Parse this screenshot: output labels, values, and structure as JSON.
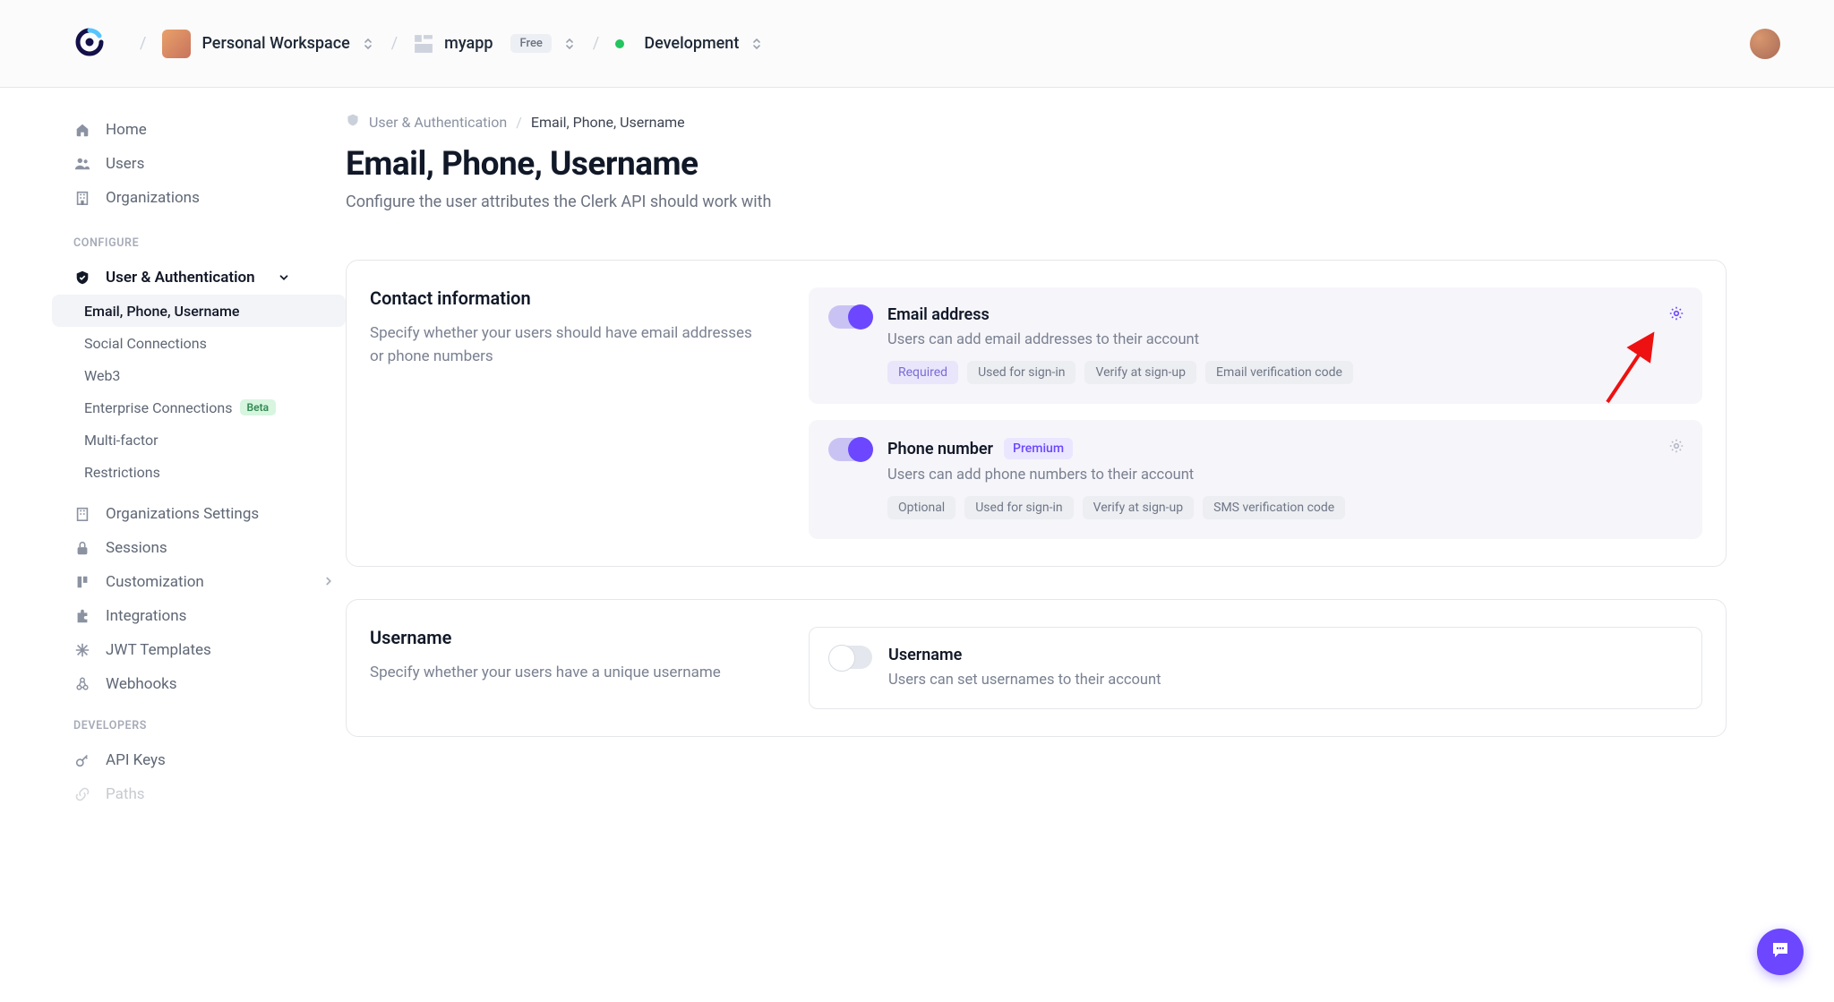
{
  "breadcrumb": {
    "workspace": "Personal Workspace",
    "app": "myapp",
    "app_badge": "Free",
    "env": "Development"
  },
  "sidebar": {
    "top": [
      {
        "label": "Home"
      },
      {
        "label": "Users"
      },
      {
        "label": "Organizations"
      }
    ],
    "config_header": "CONFIGURE",
    "auth_parent": "User & Authentication",
    "auth_children": [
      {
        "label": "Email, Phone, Username"
      },
      {
        "label": "Social Connections"
      },
      {
        "label": "Web3"
      },
      {
        "label": "Enterprise Connections",
        "beta": "Beta"
      },
      {
        "label": "Multi-factor"
      },
      {
        "label": "Restrictions"
      }
    ],
    "rest": [
      {
        "label": "Organizations Settings"
      },
      {
        "label": "Sessions"
      },
      {
        "label": "Customization"
      },
      {
        "label": "Integrations"
      },
      {
        "label": "JWT Templates"
      },
      {
        "label": "Webhooks"
      }
    ],
    "dev_header": "DEVELOPERS",
    "dev": [
      {
        "label": "API Keys"
      },
      {
        "label": "Paths"
      }
    ]
  },
  "crumbs": {
    "a": "User & Authentication",
    "b": "Email, Phone, Username"
  },
  "page": {
    "title": "Email, Phone, Username",
    "subtitle": "Configure the user attributes the Clerk API should work with"
  },
  "contact": {
    "heading": "Contact information",
    "desc": "Specify whether your users should have email addresses or phone numbers",
    "email": {
      "title": "Email address",
      "desc": "Users can add email addresses to their account",
      "chips": [
        "Required",
        "Used for sign-in",
        "Verify at sign-up",
        "Email verification code"
      ]
    },
    "phone": {
      "title": "Phone number",
      "premium": "Premium",
      "desc": "Users can add phone numbers to their account",
      "chips": [
        "Optional",
        "Used for sign-in",
        "Verify at sign-up",
        "SMS verification code"
      ]
    }
  },
  "username": {
    "heading": "Username",
    "desc": "Specify whether your users have a unique username",
    "opt": {
      "title": "Username",
      "desc": "Users can set usernames to their account"
    }
  }
}
